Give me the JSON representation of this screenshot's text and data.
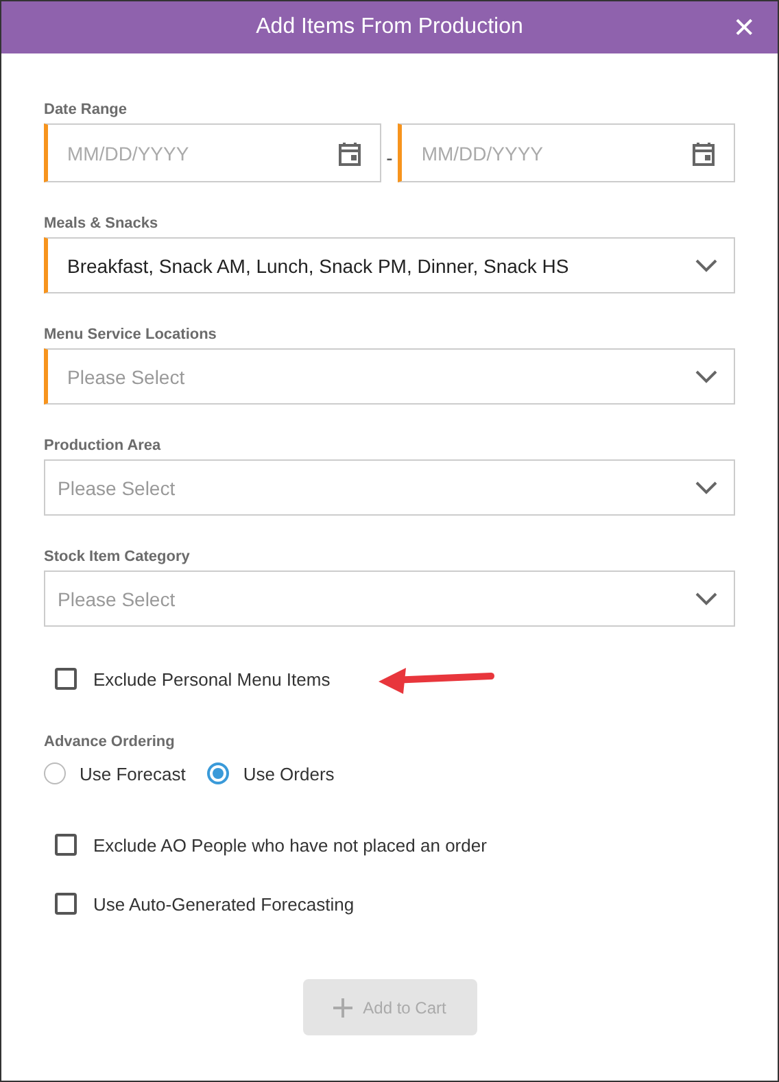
{
  "dialog": {
    "title": "Add Items From Production",
    "close": "✕"
  },
  "fields": [
    {
      "kind": "date-range",
      "label": "Date Range",
      "separator": "-",
      "inputs": [
        {
          "placeholder": "MM/DD/YYYY",
          "required": true
        },
        {
          "placeholder": "MM/DD/YYYY",
          "required": true
        }
      ]
    },
    {
      "kind": "select",
      "label": "Meals & Snacks",
      "required": true,
      "value": "Breakfast, Snack AM, Lunch, Snack PM, Dinner, Snack HS"
    },
    {
      "kind": "select",
      "label": "Menu Service Locations",
      "required": true,
      "placeholder": "Please Select"
    },
    {
      "kind": "select",
      "label": "Production Area",
      "required": false,
      "placeholder": "Please Select"
    },
    {
      "kind": "select",
      "label": "Stock Item Category",
      "required": false,
      "placeholder": "Please Select"
    }
  ],
  "exclude_personal": {
    "label": "Exclude Personal Menu Items",
    "checked": false,
    "callout": {
      "kind": "arrow"
    }
  },
  "advance_ordering": {
    "label": "Advance Ordering",
    "options": [
      {
        "label": "Use Forecast",
        "selected": false
      },
      {
        "label": "Use Orders",
        "selected": true
      }
    ]
  },
  "options": [
    {
      "label": "Exclude AO People who have not placed an order",
      "checked": false
    },
    {
      "label": "Use Auto-Generated Forecasting",
      "checked": false
    }
  ],
  "add_button": {
    "label": "Add to Cart",
    "disabled": true
  }
}
